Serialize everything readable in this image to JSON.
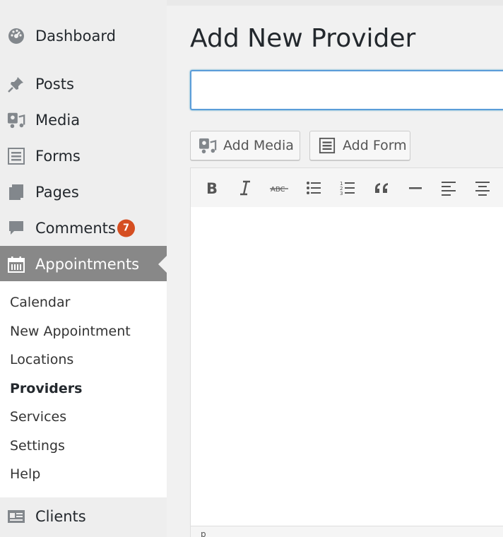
{
  "sidebar": {
    "items": [
      {
        "label": "Dashboard",
        "icon": "dashboard-icon"
      },
      {
        "label": "Posts",
        "icon": "pin-icon"
      },
      {
        "label": "Media",
        "icon": "media-icon"
      },
      {
        "label": "Forms",
        "icon": "forms-icon"
      },
      {
        "label": "Pages",
        "icon": "pages-icon"
      },
      {
        "label": "Comments",
        "icon": "comment-icon",
        "badge": "7"
      },
      {
        "label": "Appointments",
        "icon": "calendar-icon",
        "active": true
      },
      {
        "label": "Clients",
        "icon": "id-card-icon"
      }
    ],
    "submenu": [
      {
        "label": "Calendar"
      },
      {
        "label": "New Appointment"
      },
      {
        "label": "Locations"
      },
      {
        "label": "Providers",
        "current": true
      },
      {
        "label": "Services"
      },
      {
        "label": "Settings"
      },
      {
        "label": "Help"
      }
    ]
  },
  "main": {
    "title": "Add New Provider",
    "title_input": {
      "value": "",
      "placeholder": ""
    },
    "buttons": {
      "add_media": "Add Media",
      "add_form": "Add Form"
    },
    "toolbar": [
      "bold-icon",
      "italic-icon",
      "strikethrough-icon",
      "bullet-list-icon",
      "numbered-list-icon",
      "blockquote-icon",
      "horizontal-rule-icon",
      "align-left-icon",
      "align-center-icon"
    ],
    "status_path": "p"
  },
  "colors": {
    "accent_active": "#888888",
    "badge": "#d54e21",
    "focus_border": "#5b9dd9"
  }
}
